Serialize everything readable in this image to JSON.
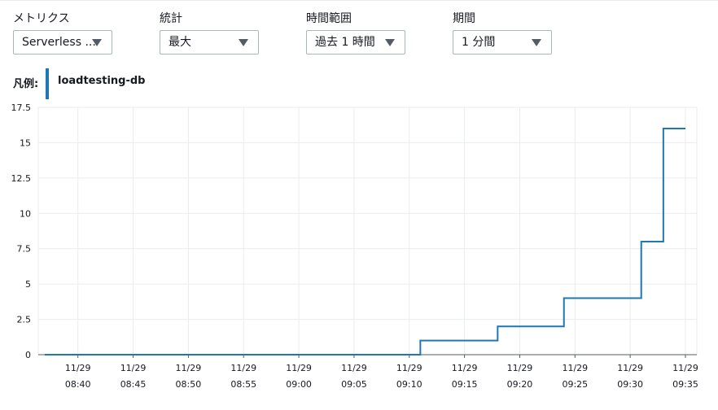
{
  "controls": {
    "metric": {
      "label": "メトリクス",
      "value": "Serverless ..."
    },
    "statistic": {
      "label": "統計",
      "value": "最大"
    },
    "time_range": {
      "label": "時間範囲",
      "value": "過去 1 時間"
    },
    "period": {
      "label": "期間",
      "value": "1 分間"
    }
  },
  "legend": {
    "title": "凡例:",
    "items": [
      "loadtesting-db"
    ]
  },
  "icons": {
    "dropdown": "caret-down-icon"
  },
  "colors": {
    "series": "#1f77b4",
    "grid": "#eaeded",
    "axis": "#545b64"
  },
  "chart_data": {
    "type": "line",
    "interpolation": "step",
    "ylim": [
      0,
      17.5
    ],
    "yticks": [
      "0",
      "2.5",
      "5",
      "7.5",
      "10",
      "12.5",
      "15",
      "17.5"
    ],
    "ytick_values": [
      0,
      2.5,
      5,
      7.5,
      10,
      12.5,
      15,
      17.5
    ],
    "xticks": [
      [
        "11/29",
        "08:40"
      ],
      [
        "11/29",
        "08:45"
      ],
      [
        "11/29",
        "08:50"
      ],
      [
        "11/29",
        "08:55"
      ],
      [
        "11/29",
        "09:00"
      ],
      [
        "11/29",
        "09:05"
      ],
      [
        "11/29",
        "09:10"
      ],
      [
        "11/29",
        "09:15"
      ],
      [
        "11/29",
        "09:20"
      ],
      [
        "11/29",
        "09:25"
      ],
      [
        "11/29",
        "09:30"
      ],
      [
        "11/29",
        "09:35"
      ]
    ],
    "xtick_times": [
      "08:40",
      "08:45",
      "08:50",
      "08:55",
      "09:00",
      "09:05",
      "09:10",
      "09:15",
      "09:20",
      "09:25",
      "09:30",
      "09:35"
    ],
    "xlim": [
      "08:37",
      "09:35"
    ],
    "grid": true,
    "series": [
      {
        "name": "loadtesting-db",
        "points": [
          [
            "08:37",
            0
          ],
          [
            "09:11",
            1
          ],
          [
            "09:18",
            2
          ],
          [
            "09:24",
            4
          ],
          [
            "09:31",
            8
          ],
          [
            "09:33",
            16
          ],
          [
            "09:35",
            16
          ]
        ]
      }
    ]
  }
}
